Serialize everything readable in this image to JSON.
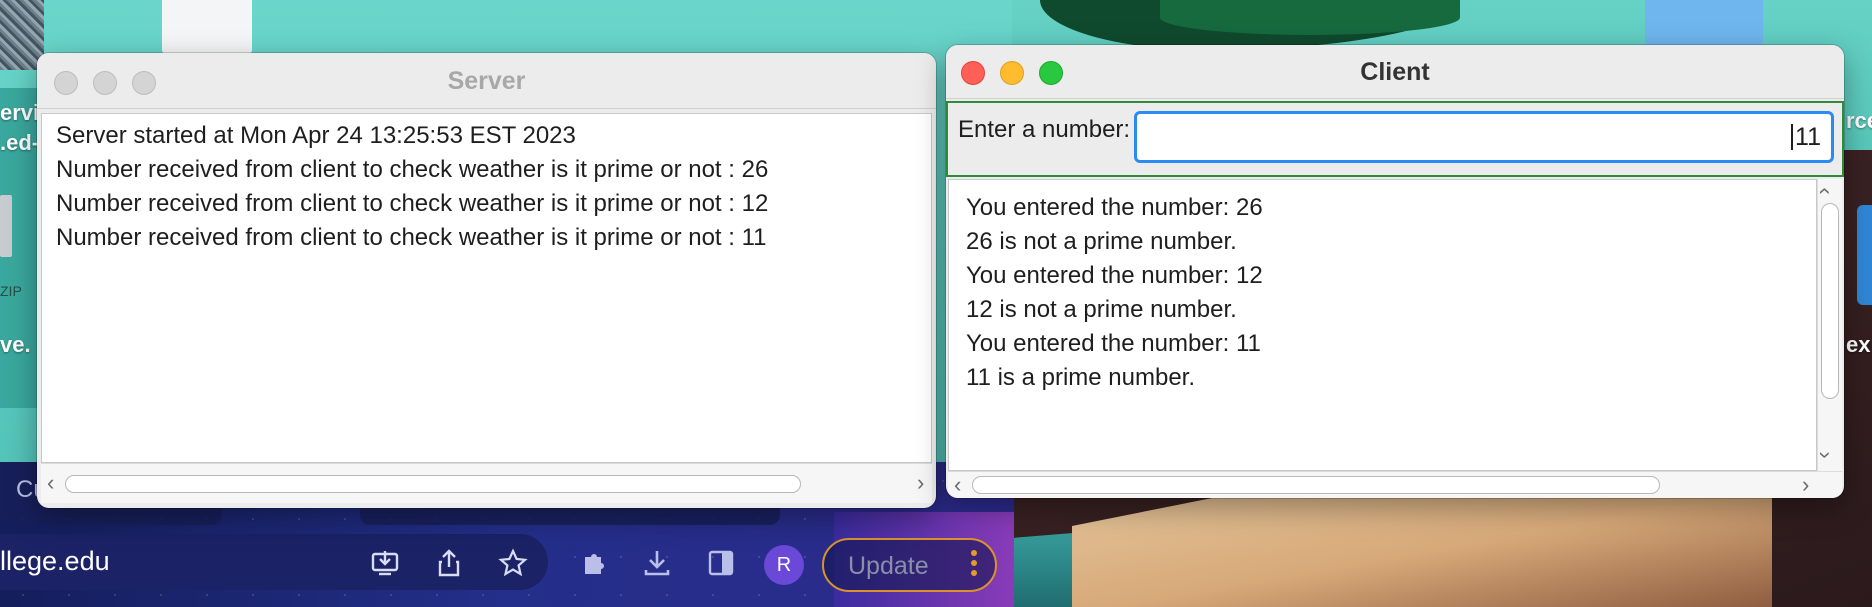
{
  "desktop": {
    "left_labels": [
      "ervi",
      ".ed-",
      "ve."
    ],
    "zip_label": "ZIP",
    "right_labels": [
      "rce",
      "ex"
    ]
  },
  "browser": {
    "tab_label": "Cu",
    "url": "llege.edu",
    "icons": [
      "install-icon",
      "share-icon",
      "star-icon",
      "extensions-icon",
      "download-icon",
      "side-panel-icon"
    ],
    "avatar_letter": "R",
    "update_label": "Update"
  },
  "server_window": {
    "title": "Server",
    "lines": [
      "Server started at Mon Apr 24 13:25:53 EST 2023",
      "Number received from client to check weather is it prime or not : 26",
      "Number received from client to check weather is it prime or not : 12",
      "Number received from client to check weather is it prime or not : 11"
    ]
  },
  "client_window": {
    "title": "Client",
    "input_label": "Enter a number:",
    "input_value": "11",
    "lines": [
      "You entered the number: 26",
      "26 is not a prime number.",
      "You entered the number: 12",
      "12 is not a prime number.",
      "You entered the number: 11",
      "11 is a prime number."
    ]
  },
  "colors": {
    "close": "#ff5f57",
    "minimize": "#febc2e",
    "zoom": "#28c840",
    "inactive": "#d4d4d4",
    "focus_ring": "#2a8bf2",
    "panel_border": "#2e8b3a"
  }
}
